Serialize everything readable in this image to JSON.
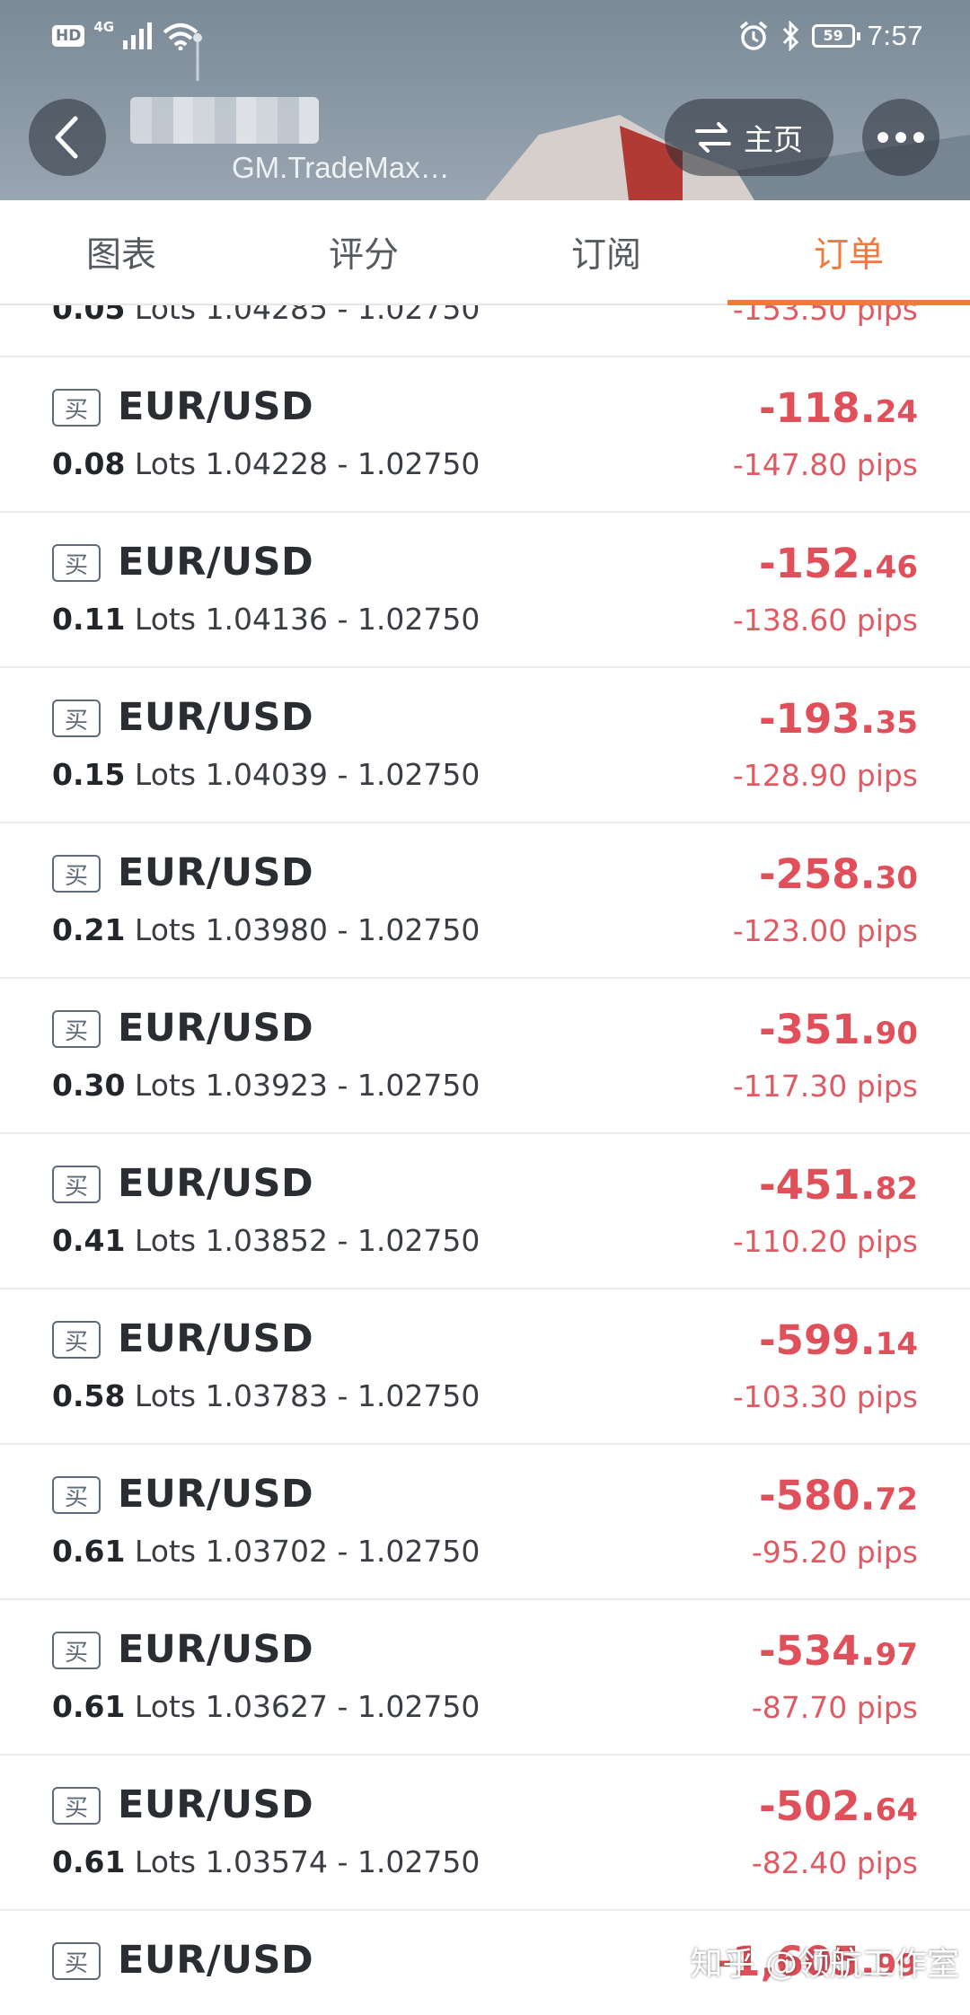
{
  "status_bar": {
    "hd": "HD",
    "network": "4G",
    "battery": "59",
    "time": "7:57"
  },
  "header": {
    "subtitle": "GM.TradeMax…",
    "home_label": "主页"
  },
  "tabs": [
    {
      "label": "图表",
      "active": false
    },
    {
      "label": "评分",
      "active": false
    },
    {
      "label": "订阅",
      "active": false
    },
    {
      "label": "订单",
      "active": true
    }
  ],
  "orders_partial_top": {
    "lots": "0.05",
    "lots_unit": "Lots",
    "prices": "1.04285 - 1.02750",
    "pips": "-153.50 pips"
  },
  "orders": [
    {
      "side": "买",
      "symbol": "EUR/USD",
      "lots": "0.08",
      "lots_unit": "Lots",
      "prices": "1.04228 - 1.02750",
      "profit_int": "-118.",
      "profit_dec": "24",
      "pips": "-147.80 pips"
    },
    {
      "side": "买",
      "symbol": "EUR/USD",
      "lots": "0.11",
      "lots_unit": "Lots",
      "prices": "1.04136 - 1.02750",
      "profit_int": "-152.",
      "profit_dec": "46",
      "pips": "-138.60 pips"
    },
    {
      "side": "买",
      "symbol": "EUR/USD",
      "lots": "0.15",
      "lots_unit": "Lots",
      "prices": "1.04039 - 1.02750",
      "profit_int": "-193.",
      "profit_dec": "35",
      "pips": "-128.90 pips"
    },
    {
      "side": "买",
      "symbol": "EUR/USD",
      "lots": "0.21",
      "lots_unit": "Lots",
      "prices": "1.03980 - 1.02750",
      "profit_int": "-258.",
      "profit_dec": "30",
      "pips": "-123.00 pips"
    },
    {
      "side": "买",
      "symbol": "EUR/USD",
      "lots": "0.30",
      "lots_unit": "Lots",
      "prices": "1.03923 - 1.02750",
      "profit_int": "-351.",
      "profit_dec": "90",
      "pips": "-117.30 pips"
    },
    {
      "side": "买",
      "symbol": "EUR/USD",
      "lots": "0.41",
      "lots_unit": "Lots",
      "prices": "1.03852 - 1.02750",
      "profit_int": "-451.",
      "profit_dec": "82",
      "pips": "-110.20 pips"
    },
    {
      "side": "买",
      "symbol": "EUR/USD",
      "lots": "0.58",
      "lots_unit": "Lots",
      "prices": "1.03783 - 1.02750",
      "profit_int": "-599.",
      "profit_dec": "14",
      "pips": "-103.30 pips"
    },
    {
      "side": "买",
      "symbol": "EUR/USD",
      "lots": "0.61",
      "lots_unit": "Lots",
      "prices": "1.03702 - 1.02750",
      "profit_int": "-580.",
      "profit_dec": "72",
      "pips": "-95.20 pips"
    },
    {
      "side": "买",
      "symbol": "EUR/USD",
      "lots": "0.61",
      "lots_unit": "Lots",
      "prices": "1.03627 - 1.02750",
      "profit_int": "-534.",
      "profit_dec": "97",
      "pips": "-87.70 pips"
    },
    {
      "side": "买",
      "symbol": "EUR/USD",
      "lots": "0.61",
      "lots_unit": "Lots",
      "prices": "1.03574 - 1.02750",
      "profit_int": "-502.",
      "profit_dec": "64",
      "pips": "-82.40 pips"
    },
    {
      "side": "买",
      "symbol": "EUR/USD",
      "lots": "",
      "lots_unit": "",
      "prices": "",
      "profit_int": "-1,605.",
      "profit_dec": "99",
      "pips": ""
    }
  ],
  "watermark": "知乎 @领航工作室",
  "colors": {
    "accent": "#ef7a3e",
    "loss": "#e0505a",
    "text_primary": "#2a2e33",
    "divider": "#ededed"
  },
  "icons": {
    "back": "chevron-left-icon",
    "switch": "swap-arrows-icon",
    "more": "more-dots-icon",
    "alarm": "alarm-icon",
    "bluetooth": "bluetooth-icon",
    "wifi": "wifi-icon",
    "signal": "signal-icon"
  }
}
